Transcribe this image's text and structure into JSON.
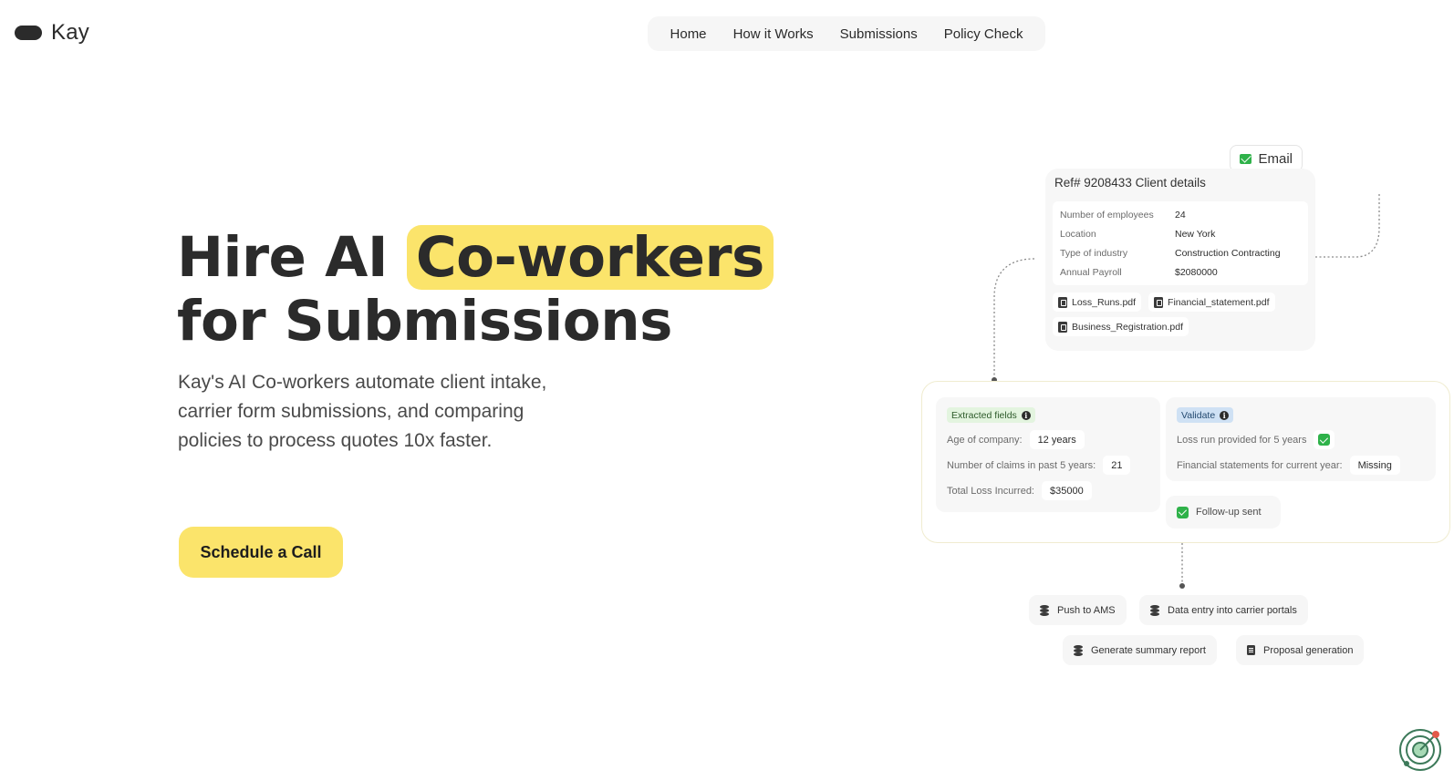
{
  "brand": {
    "name": "Kay"
  },
  "nav": {
    "items": [
      "Home",
      "How it Works",
      "Submissions",
      "Policy Check"
    ]
  },
  "hero": {
    "title_part1": "Hire AI",
    "title_highlight": "Co-workers",
    "title_part2": "for Submissions",
    "subtitle": "Kay's AI Co-workers automate client intake, carrier form submissions, and comparing policies to process quotes 10x faster.",
    "cta_label": "Schedule a Call"
  },
  "email_chip": {
    "label": "Email",
    "icon": "envelope-icon"
  },
  "client_card": {
    "title": "Ref# 9208433 Client details",
    "details": [
      {
        "label": "Number of employees",
        "value": "24"
      },
      {
        "label": "Location",
        "value": "New York"
      },
      {
        "label": "Type of industry",
        "value": "Construction Contracting"
      },
      {
        "label": "Annual Payroll",
        "value": "$2080000"
      }
    ],
    "files": [
      "Loss_Runs.pdf",
      "Financial_statement.pdf",
      "Business_Registration.pdf"
    ]
  },
  "extracted": {
    "badge": "Extracted fields",
    "fields": [
      {
        "label": "Age of company:",
        "value": "12 years"
      },
      {
        "label": "Number of claims in past 5 years:",
        "value": "21"
      },
      {
        "label": "Total Loss Incurred:",
        "value": "$35000"
      }
    ]
  },
  "validate": {
    "badge": "Validate",
    "loss_run_label": "Loss run provided for 5 years",
    "financial_label": "Financial statements for current year:",
    "financial_value": "Missing"
  },
  "followup": {
    "label": "Follow-up sent"
  },
  "actions": [
    "Push to AMS",
    "Data entry into carrier portals",
    "Generate summary report",
    "Proposal generation"
  ],
  "colors": {
    "accent": "#fbe46b",
    "success": "#2fb24a",
    "validate_badge": "#cfe1f4",
    "extracted_badge": "#e3f4df"
  }
}
